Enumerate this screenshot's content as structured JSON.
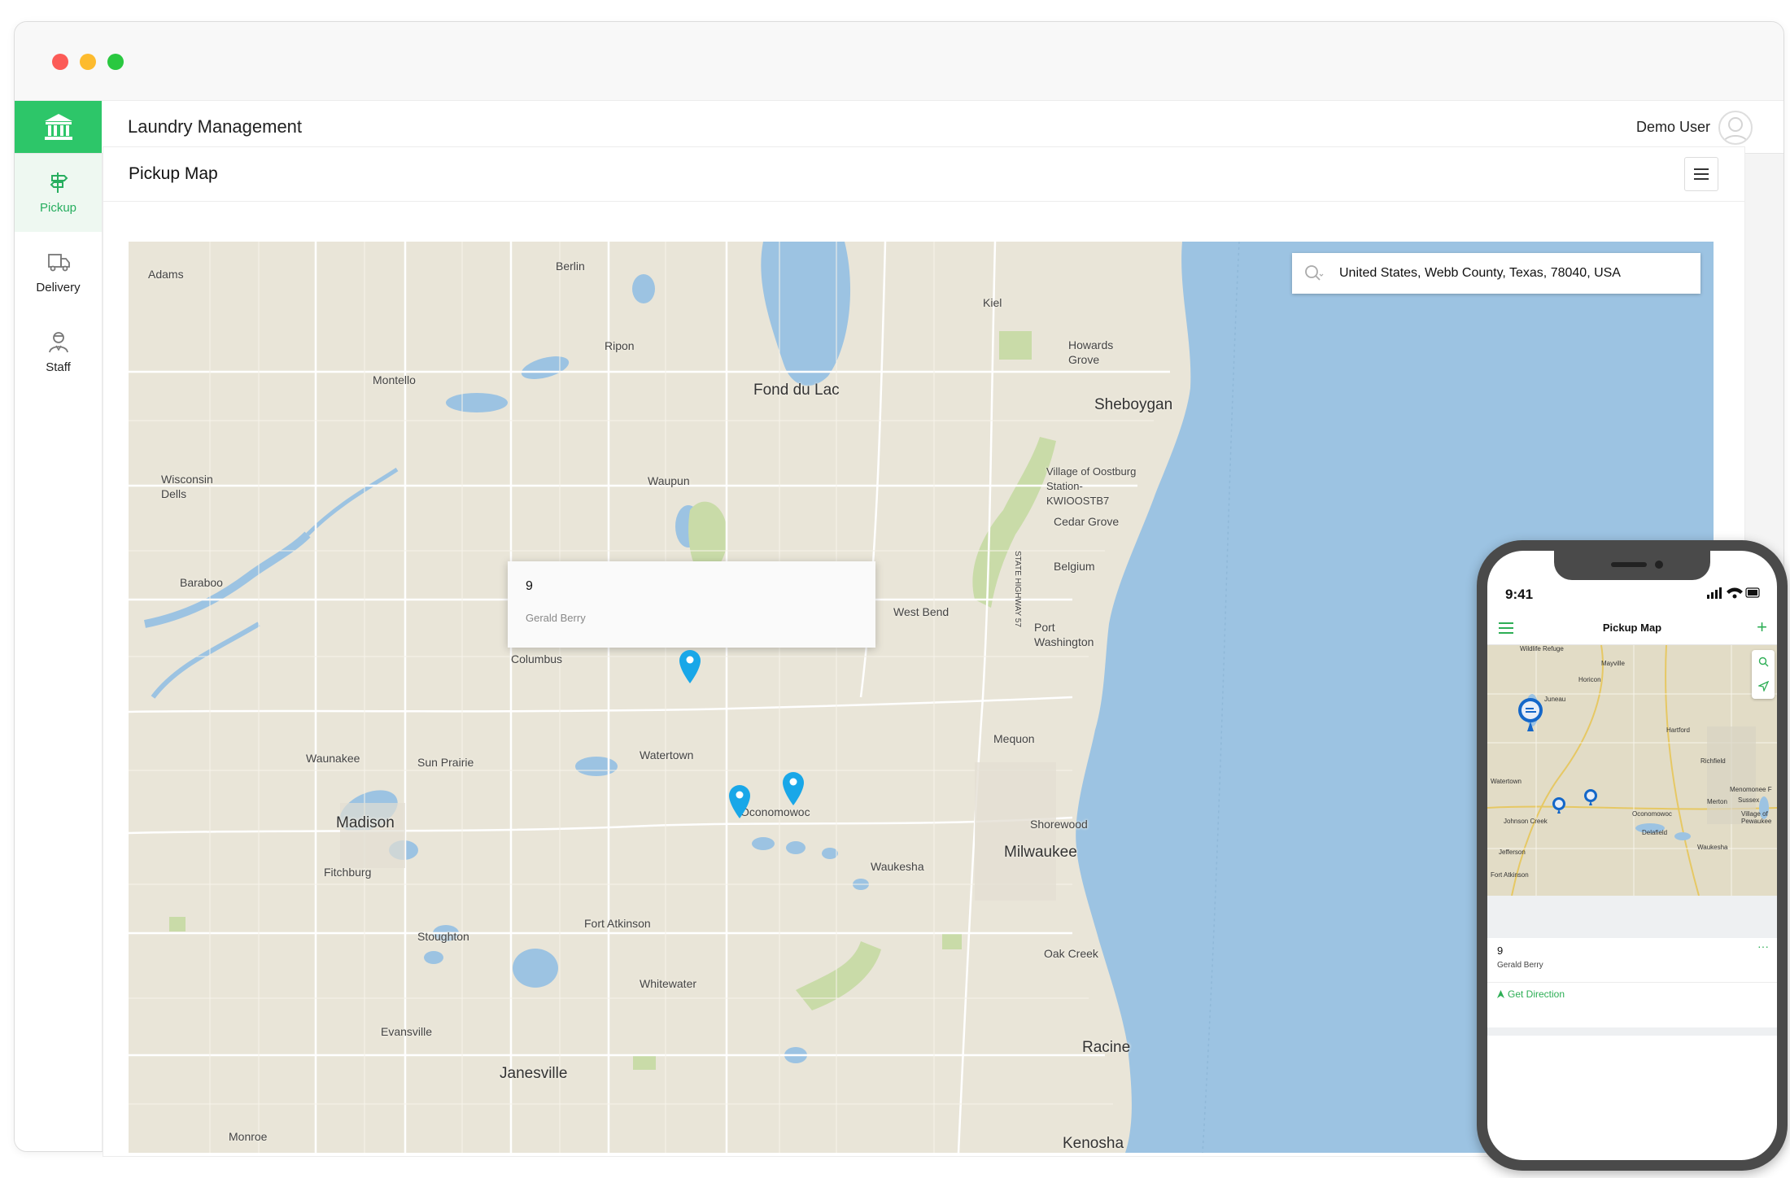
{
  "header": {
    "app_title": "Laundry Management",
    "user_name": "Demo User"
  },
  "sidebar": {
    "items": [
      {
        "label": "Pickup",
        "icon": "signpost-icon",
        "active": true
      },
      {
        "label": "Delivery",
        "icon": "truck-icon",
        "active": false
      },
      {
        "label": "Staff",
        "icon": "staff-icon",
        "active": false
      }
    ]
  },
  "panel": {
    "title": "Pickup Map"
  },
  "map": {
    "search_value": "United States, Webb County, Texas, 78040, USA",
    "popup": {
      "number": "9",
      "name": "Gerald Berry"
    },
    "labels": {
      "adams": "Adams",
      "berlin": "Berlin",
      "kiel": "Kiel",
      "ripon": "Ripon",
      "howards_grove": "Howards Grove",
      "montello": "Montello",
      "fond_du_lac": "Fond du Lac",
      "sheboygan": "Sheboygan",
      "wisconsin_dells": "Wisconsin Dells",
      "waupun": "Waupun",
      "village_of": "Village of Oostburg Station-KWIOOSTB7",
      "cedar_grove": "Cedar Grove",
      "highway": "STATE HIGHWAY 57",
      "belgium": "Belgium",
      "baraboo": "Baraboo",
      "west_bend": "West Bend",
      "port_washington": "Port Washington",
      "columbus": "Columbus",
      "mequon": "Mequon",
      "waunakee": "Waunakee",
      "sun_prairie": "Sun Prairie",
      "watertown": "Watertown",
      "oconomowoc": "Oconomowoc",
      "madison": "Madison",
      "shorewood": "Shorewood",
      "milwaukee": "Milwaukee",
      "fitchburg": "Fitchburg",
      "waukesha": "Waukesha",
      "fort_atkinson": "Fort Atkinson",
      "stoughton": "Stoughton",
      "oak_creek": "Oak Creek",
      "whitewater": "Whitewater",
      "evansville": "Evansville",
      "racine": "Racine",
      "janesville": "Janesville",
      "monroe": "Monroe",
      "kenosha": "Kenosha"
    }
  },
  "phone": {
    "time": "9:41",
    "title": "Pickup Map",
    "map_labels": {
      "wildlife": "Wildlife Refuge",
      "mayville": "Mayville",
      "horicon": "Horicon",
      "juneau": "Juneau",
      "hartford": "Hartford",
      "richfield": "Richfield",
      "watertown": "Watertown",
      "menomonee": "Menomonee F",
      "sussex": "Sussex",
      "merton": "Merton",
      "oconomowoc": "Oconomowoc",
      "village_of": "Village of",
      "pewaukee": "Pewaukee",
      "johnson_creek": "Johnson Creek",
      "delafield": "Delafield",
      "waukesha": "Waukesha",
      "jefferson": "Jefferson",
      "fort_atkinson": "Fort Atkinson"
    },
    "card": {
      "number": "9",
      "name": "Gerald Berry",
      "more": "···",
      "direction": "Get Direction"
    }
  },
  "colors": {
    "accent": "#2dc669",
    "pin": "#19a7e8",
    "water": "#9cc3e2",
    "land": "#e9e5d8"
  }
}
